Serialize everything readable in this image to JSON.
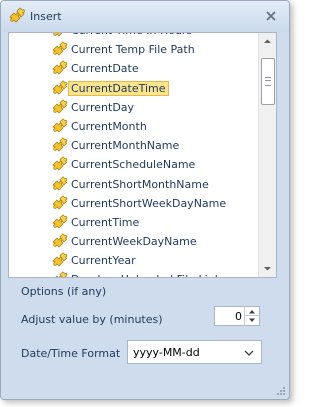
{
  "window": {
    "title": "Insert"
  },
  "list": {
    "items": [
      "Current Time In Hours",
      "Current Temp File Path",
      "CurrentDate",
      "CurrentDateTime",
      "CurrentDay",
      "CurrentMonth",
      "CurrentMonthName",
      "CurrentScheduleName",
      "CurrentShortMonthName",
      "CurrentShortWeekDayName",
      "CurrentTime",
      "CurrentWeekDayName",
      "CurrentYear",
      "Dropbox Uploaded File Link"
    ],
    "selected": "CurrentDateTime",
    "icon": "puzzle-piece-icon"
  },
  "options": {
    "header": "Options (if any)",
    "adjust_label": "Adjust value by (minutes)",
    "adjust_value": "0",
    "format_label": "Date/Time Format",
    "format_value": "yyyy-MM-dd"
  },
  "colors": {
    "selection_bg": "#fce48d",
    "text": "#1e395b",
    "window_bg": "#cfdcee"
  }
}
